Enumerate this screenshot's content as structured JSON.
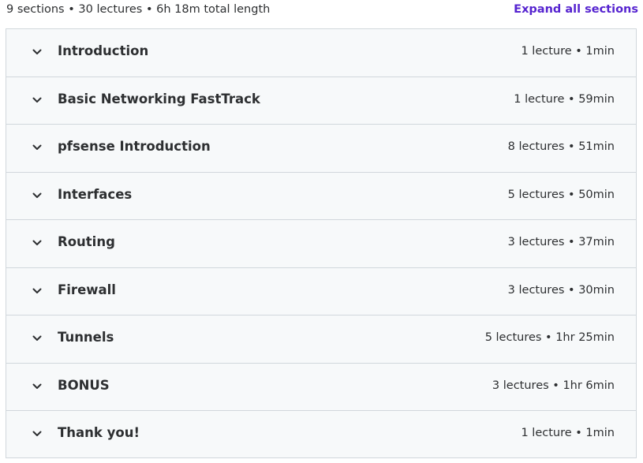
{
  "summary": {
    "text": "9 sections • 30 lectures • 6h 18m total length",
    "expand_label": "Expand all sections"
  },
  "colors": {
    "accent": "#5624d0",
    "row_background": "#f7f9fa",
    "border": "#d1d7dc",
    "text": "#2d2f31"
  },
  "icons": {
    "section_toggle": "chevron-down-icon"
  },
  "sections": [
    {
      "title": "Introduction",
      "meta": "1 lecture • 1min"
    },
    {
      "title": "Basic Networking FastTrack",
      "meta": "1 lecture • 59min"
    },
    {
      "title": "pfsense Introduction",
      "meta": "8 lectures • 51min"
    },
    {
      "title": "Interfaces",
      "meta": "5 lectures • 50min"
    },
    {
      "title": "Routing",
      "meta": "3 lectures • 37min"
    },
    {
      "title": "Firewall",
      "meta": "3 lectures • 30min"
    },
    {
      "title": "Tunnels",
      "meta": "5 lectures • 1hr 25min"
    },
    {
      "title": "BONUS",
      "meta": "3 lectures • 1hr 6min"
    },
    {
      "title": "Thank you!",
      "meta": "1 lecture • 1min"
    }
  ]
}
